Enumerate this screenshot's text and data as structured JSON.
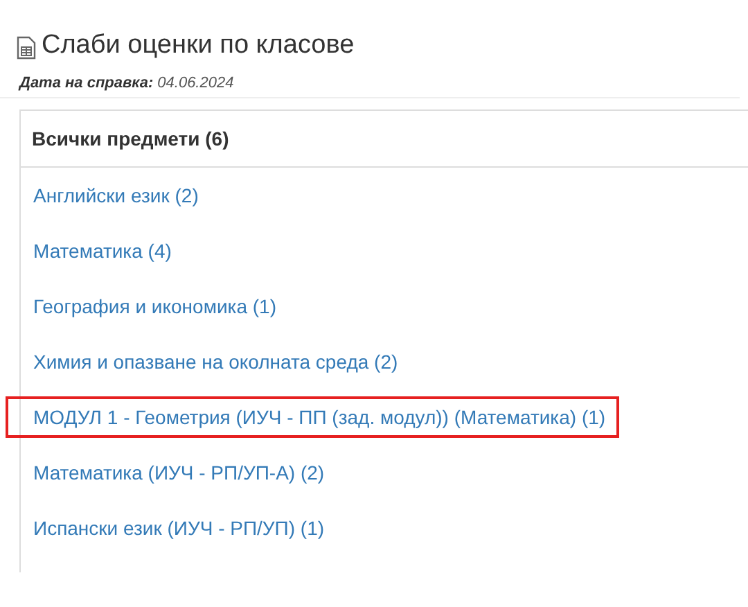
{
  "title": "Слаби оценки по класове",
  "report_date": {
    "label": "Дата на справка:",
    "value": "04.06.2024"
  },
  "list_header": "Всички предмети (6)",
  "subjects": [
    {
      "label": "Английски език (2)",
      "highlighted": false
    },
    {
      "label": "Математика (4)",
      "highlighted": false
    },
    {
      "label": "География и икономика (1)",
      "highlighted": false
    },
    {
      "label": "Химия и опазване на околната среда (2)",
      "highlighted": false
    },
    {
      "label": "МОДУЛ 1 - Геометрия (ИУЧ - ПП (зад. модул)) (Математика) (1)",
      "highlighted": true
    },
    {
      "label": "Математика (ИУЧ - РП/УП-А) (2)",
      "highlighted": false
    },
    {
      "label": "Испански език (ИУЧ - РП/УП) (1)",
      "highlighted": false
    }
  ]
}
